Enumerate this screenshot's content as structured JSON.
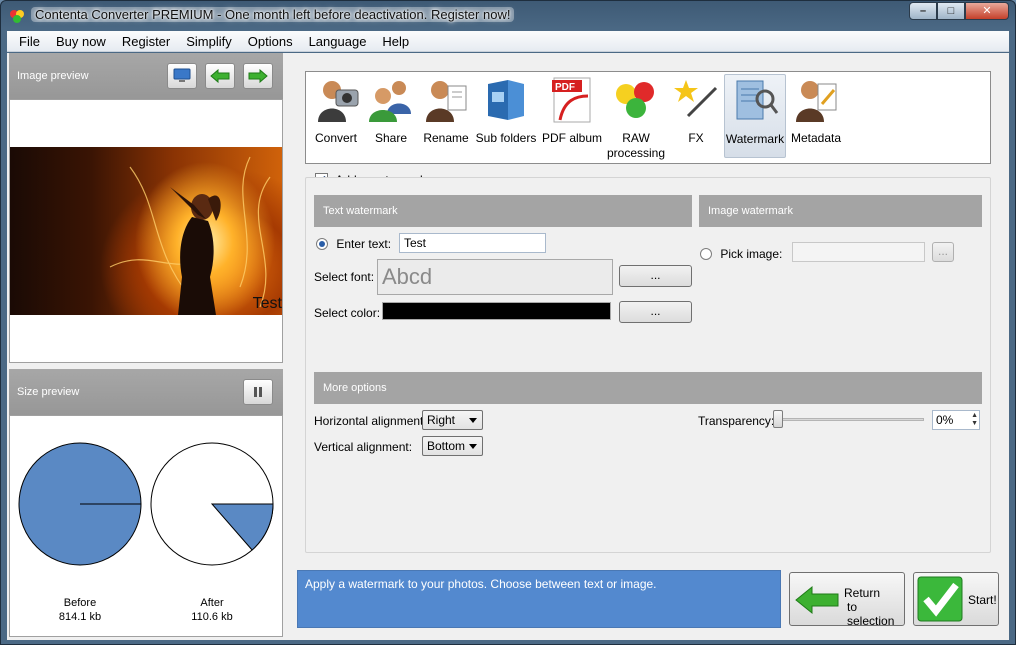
{
  "window": {
    "title": "Contenta Converter PREMIUM  - One month left before deactivation. Register now!",
    "minimize": "–",
    "maximize": "□",
    "close": "✕"
  },
  "menu": [
    "File",
    "Buy now",
    "Register",
    "Simplify",
    "Options",
    "Language",
    "Help"
  ],
  "left": {
    "image_preview_label": "Image preview",
    "photo_watermark": "Test",
    "size_preview_label": "Size preview",
    "before_label": "Before",
    "before_size": "814.1 kb",
    "after_label": "After",
    "after_size": "110.6 kb",
    "after_fraction": 0.136
  },
  "tools": [
    {
      "label": "Convert",
      "icon": "convert-icon"
    },
    {
      "label": "Share",
      "icon": "share-icon"
    },
    {
      "label": "Rename",
      "icon": "rename-icon"
    },
    {
      "label": "Sub folders",
      "icon": "subfolders-icon"
    },
    {
      "label": "PDF album",
      "icon": "pdf-album-icon"
    },
    {
      "label": "RAW processing",
      "icon": "raw-processing-icon"
    },
    {
      "label": "FX",
      "icon": "fx-icon"
    },
    {
      "label": "Watermark",
      "icon": "watermark-icon"
    },
    {
      "label": "Metadata",
      "icon": "metadata-icon"
    }
  ],
  "pdf_badge": "PDF",
  "watermark": {
    "add_label": "Add a watermark",
    "add_checked": true,
    "text_section": "Text watermark",
    "image_section": "Image watermark",
    "enter_text_label": "Enter text:",
    "text_value": "Test",
    "select_font_label": "Select font:",
    "font_sample": "Abcd",
    "select_color_label": "Select color:",
    "color_value": "#000000",
    "browse": "...",
    "pick_image_label": "Pick image:",
    "pick_image_value": "",
    "more_options": "More options",
    "h_align_label": "Horizontal alignment:",
    "h_align_value": "Right",
    "v_align_label": "Vertical alignment:",
    "v_align_value": "Bottom",
    "transparency_label": "Transparency:",
    "transparency_value": "0%"
  },
  "info_text": "Apply a watermark to your photos. Choose between text or image.",
  "return_label_1": "Return",
  "return_label_2": "to selection",
  "start_label": "Start!"
}
